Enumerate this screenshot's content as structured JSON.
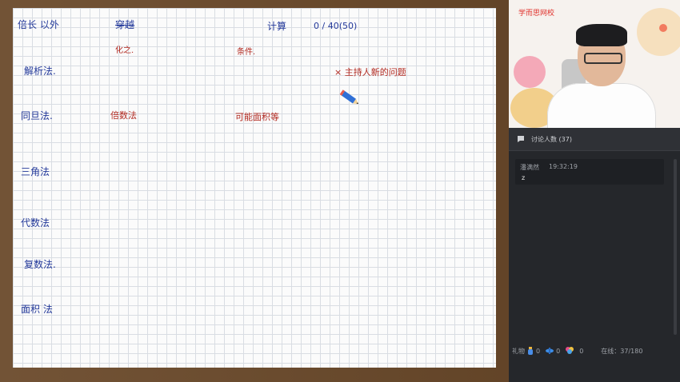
{
  "board": {
    "methods": [
      "倍长 以外",
      "解析法.",
      "同旦法.",
      "三角法",
      "代数法",
      "复数法.",
      "面积 法"
    ],
    "crossed_word": "穿越",
    "calc_label": "计算",
    "calc_value": "0 / 40(50)",
    "note1": "化之.",
    "note2": "条件.",
    "note3": "倍数法",
    "note4": "可能面积等",
    "cross_note": "× 主持人新的问题"
  },
  "sidebar": {
    "brand": "学而思网校",
    "discussion_title": "讨论人数 (37)",
    "message": {
      "name": "潘满然",
      "time": "19:32:19",
      "text": "z"
    },
    "gifts_label": "礼物",
    "gift_counts": [
      "0",
      "0",
      "0"
    ],
    "online_label": "在线：",
    "online_value": "37/180"
  },
  "colors": {
    "ink_blue": "#23399a",
    "ink_red": "#b1281f",
    "frame": "#6b4a2b",
    "brand": "#e0302a"
  },
  "icons": [
    "chat-bubble-icon",
    "pencil-icon",
    "gift-bottle-icon",
    "gift-plane-icon",
    "gift-balloons-icon"
  ]
}
